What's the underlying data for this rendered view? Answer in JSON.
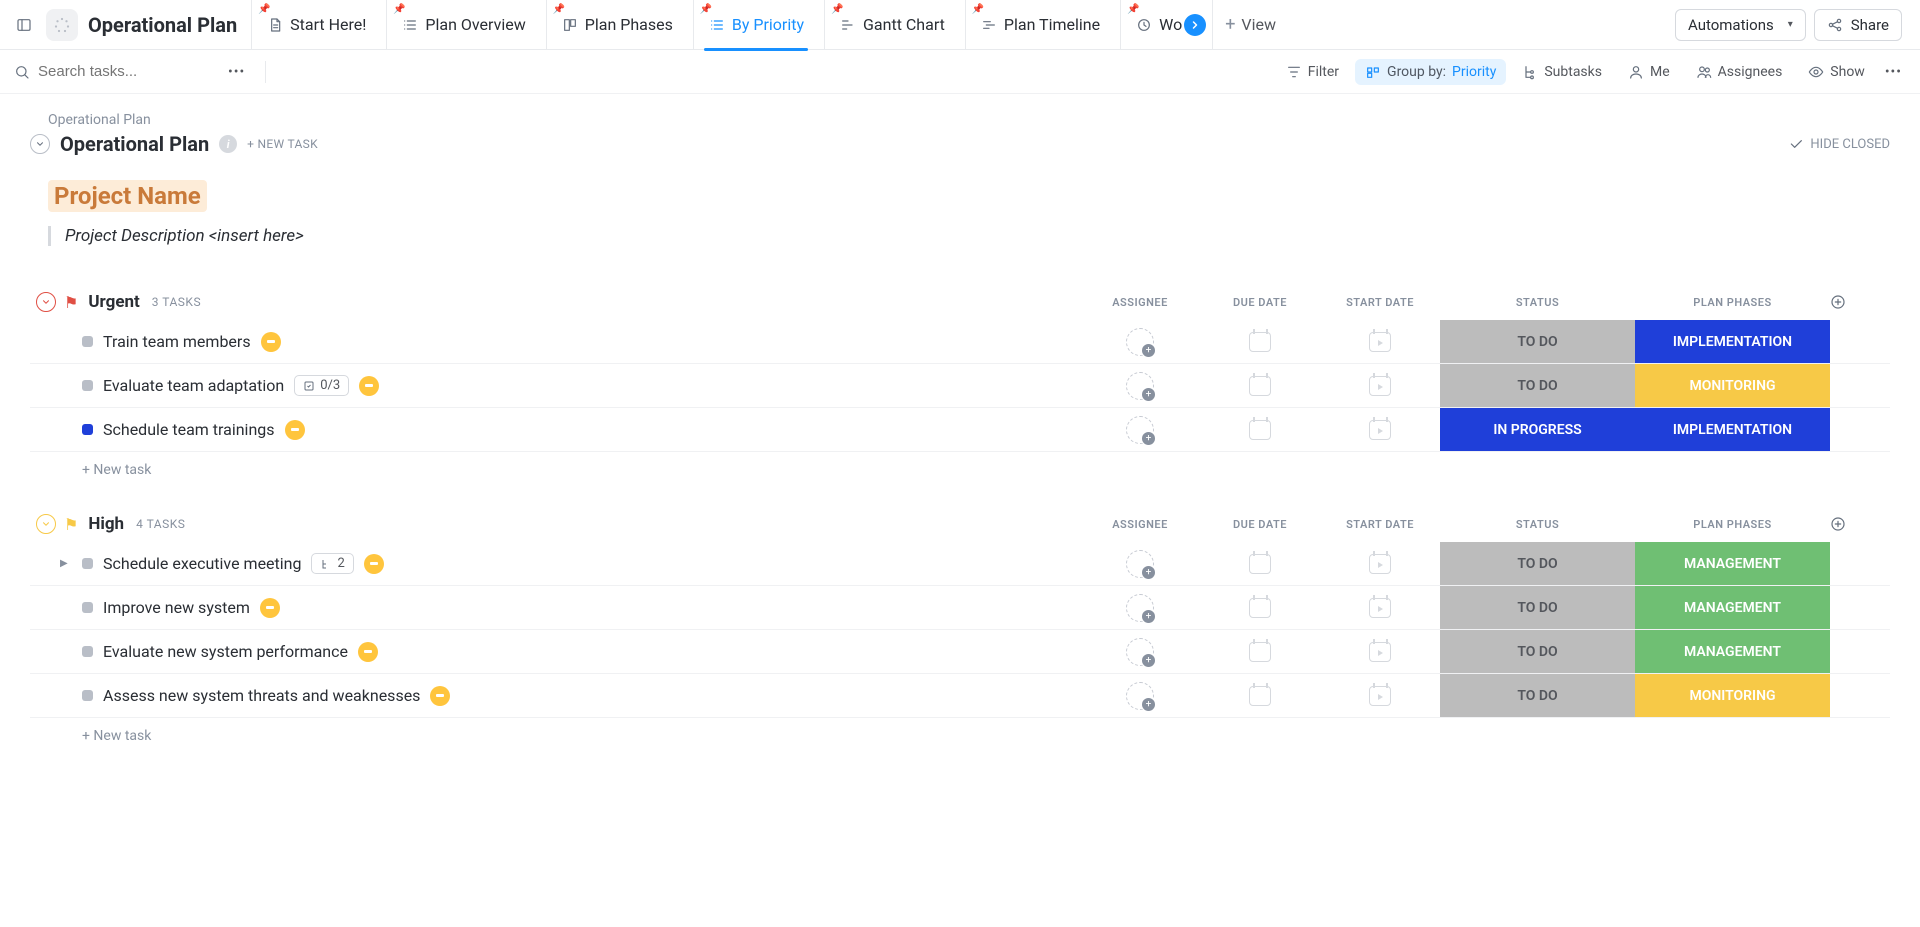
{
  "header": {
    "title": "Operational Plan",
    "tabs": [
      {
        "label": "Start Here!"
      },
      {
        "label": "Plan Overview"
      },
      {
        "label": "Plan Phases"
      },
      {
        "label": "By Priority",
        "active": true
      },
      {
        "label": "Gantt Chart"
      },
      {
        "label": "Plan Timeline"
      },
      {
        "label": "Wo"
      }
    ],
    "view_btn": "View",
    "automations": "Automations",
    "share": "Share"
  },
  "toolbar": {
    "search_placeholder": "Search tasks...",
    "filter": "Filter",
    "group_label": "Group by:",
    "group_value": "Priority",
    "subtasks": "Subtasks",
    "me": "Me",
    "assignees": "Assignees",
    "show": "Show"
  },
  "page": {
    "breadcrumb": "Operational Plan",
    "title": "Operational Plan",
    "new_task_btn": "+ NEW TASK",
    "hide_closed": "HIDE CLOSED",
    "project_name": "Project Name",
    "project_desc": "Project Description <insert here>"
  },
  "columns": {
    "assignee": "ASSIGNEE",
    "due_date": "DUE DATE",
    "start_date": "START DATE",
    "status": "STATUS",
    "plan_phases": "PLAN PHASES"
  },
  "groups": [
    {
      "name": "Urgent",
      "color": "red",
      "count_label": "3 TASKS",
      "tasks": [
        {
          "name": "Train team members",
          "status": "TO DO",
          "status_class": "status-todo",
          "phase": "IMPLEMENTATION",
          "phase_class": "phase-impl",
          "sq": "grey",
          "yellow_badge": true
        },
        {
          "name": "Evaluate team adaptation",
          "status": "TO DO",
          "status_class": "status-todo",
          "phase": "MONITORING",
          "phase_class": "phase-monitor",
          "sq": "grey",
          "yellow_badge": true,
          "checklist": "0/3"
        },
        {
          "name": "Schedule team trainings",
          "status": "IN PROGRESS",
          "status_class": "status-inprog",
          "phase": "IMPLEMENTATION",
          "phase_class": "phase-impl",
          "sq": "blue",
          "yellow_badge": true
        }
      ],
      "new_task": "+ New task"
    },
    {
      "name": "High",
      "color": "yellow",
      "count_label": "4 TASKS",
      "tasks": [
        {
          "name": "Schedule executive meeting",
          "status": "TO DO",
          "status_class": "status-todo",
          "phase": "MANAGEMENT",
          "phase_class": "phase-manage",
          "sq": "grey",
          "yellow_badge": true,
          "subtasks": "2",
          "expand": true
        },
        {
          "name": "Improve new system",
          "status": "TO DO",
          "status_class": "status-todo",
          "phase": "MANAGEMENT",
          "phase_class": "phase-manage",
          "sq": "grey",
          "yellow_badge": true
        },
        {
          "name": "Evaluate new system performance",
          "status": "TO DO",
          "status_class": "status-todo",
          "phase": "MANAGEMENT",
          "phase_class": "phase-manage",
          "sq": "grey",
          "yellow_badge": true
        },
        {
          "name": "Assess new system threats and weaknesses",
          "status": "TO DO",
          "status_class": "status-todo",
          "phase": "MONITORING",
          "phase_class": "phase-monitor",
          "sq": "grey",
          "yellow_badge": true
        }
      ],
      "new_task": "+ New task"
    }
  ]
}
